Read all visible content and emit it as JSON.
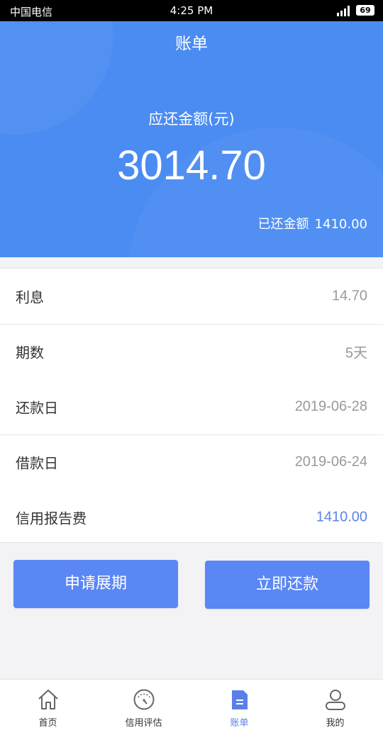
{
  "status_bar": {
    "carrier": "中国电信",
    "time": "4:25 PM",
    "battery": "69"
  },
  "header": {
    "title": "账单",
    "amount_label": "应还金额(元)",
    "amount_value": "3014.70",
    "paid_label": "已还金额",
    "paid_value": "1410.00"
  },
  "details": [
    {
      "label": "利息",
      "value": "14.70"
    },
    {
      "label": "期数",
      "value": "5天"
    },
    {
      "label": "还款日",
      "value": "2019-06-28"
    },
    {
      "label": "借款日",
      "value": "2019-06-24"
    },
    {
      "label": "信用报告费",
      "value": "1410.00"
    }
  ],
  "buttons": {
    "extend": "申请展期",
    "repay": "立即还款"
  },
  "tabs": [
    {
      "label": "首页",
      "icon": "home-icon"
    },
    {
      "label": "信用评估",
      "icon": "gauge-icon"
    },
    {
      "label": "账单",
      "icon": "bill-icon",
      "active": true
    },
    {
      "label": "我的",
      "icon": "user-icon"
    }
  ],
  "colors": {
    "header_bg": "#4b8cf2",
    "button_bg": "#5b87f5",
    "accent_text": "#5b85e8",
    "page_bg": "#f3f2f5"
  }
}
